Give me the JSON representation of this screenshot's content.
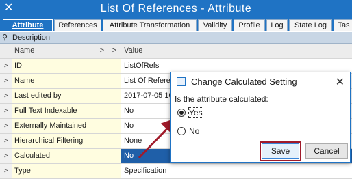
{
  "window": {
    "title": "List Of References - Attribute",
    "close_glyph": "✕"
  },
  "tabs": [
    {
      "label": "Attribute"
    },
    {
      "label": "References"
    },
    {
      "label": "Attribute Transformation"
    },
    {
      "label": "Validity"
    },
    {
      "label": "Profile"
    },
    {
      "label": "Log"
    },
    {
      "label": "State Log"
    },
    {
      "label": "Tas"
    }
  ],
  "description_row": {
    "label": "Description"
  },
  "grid": {
    "header": {
      "name": "Name",
      "value": "Value"
    },
    "rows": [
      {
        "name": "ID",
        "value": "ListOfRefs"
      },
      {
        "name": "Name",
        "value": "List Of References"
      },
      {
        "name": "Last edited by",
        "value": "2017-07-05 10:"
      },
      {
        "name": "Full Text Indexable",
        "value": "No"
      },
      {
        "name": "Externally Maintained",
        "value": "No"
      },
      {
        "name": "Hierarchical Filtering",
        "value": "None"
      },
      {
        "name": "Calculated",
        "value": "No"
      },
      {
        "name": "Type",
        "value": "Specification"
      }
    ]
  },
  "dialog": {
    "title": "Change Calculated Setting",
    "question": "Is the attribute calculated:",
    "options": [
      {
        "label": "Yes",
        "selected": true
      },
      {
        "label": "No",
        "selected": false
      }
    ],
    "save_label": "Save",
    "cancel_label": "Cancel",
    "close_glyph": "✕"
  },
  "colors": {
    "accent": "#1f73c4",
    "annotation": "#a01a2a",
    "name_column": "#fffde0"
  }
}
